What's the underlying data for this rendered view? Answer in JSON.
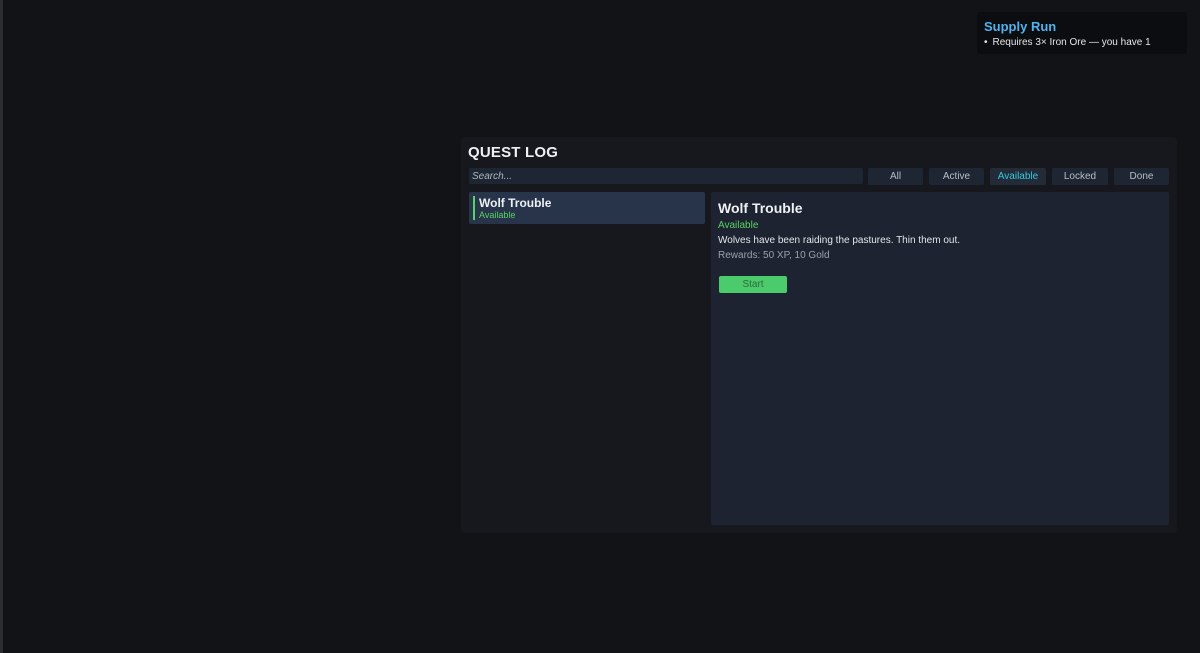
{
  "tracker": {
    "title": "Supply Run",
    "requirements": [
      {
        "bullet": "•",
        "text": "Requires 3× Iron Ore — you have 1"
      }
    ]
  },
  "quest_log": {
    "title": "QUEST LOG",
    "search": {
      "placeholder": "Search...",
      "value": ""
    },
    "filters": [
      {
        "label": "All",
        "selected": false
      },
      {
        "label": "Active",
        "selected": false
      },
      {
        "label": "Available",
        "selected": true
      },
      {
        "label": "Locked",
        "selected": false
      },
      {
        "label": "Done",
        "selected": false
      }
    ],
    "quests": [
      {
        "name": "Wolf Trouble",
        "status": "Available"
      }
    ],
    "detail": {
      "title": "Wolf Trouble",
      "status": "Available",
      "description": "Wolves have been raiding the pastures. Thin them out.",
      "rewards": "Rewards: 50 XP, 10 Gold",
      "action_label": "Start"
    }
  },
  "colors": {
    "background": "#121316",
    "tracker_title": "#4fb3ef",
    "status_available": "#56d364",
    "filter_selected": "#35c8de",
    "start_button": "#4ccb6c"
  }
}
